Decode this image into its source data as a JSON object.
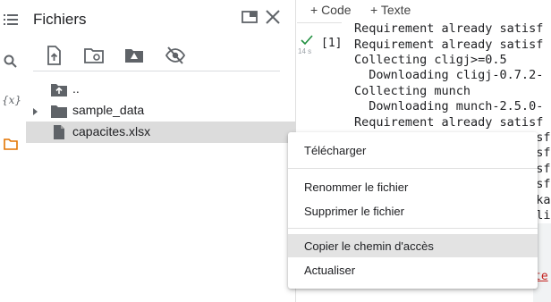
{
  "rail": {
    "icons": [
      "table-of-contents-icon",
      "search-icon",
      "variables-icon",
      "folder-icon"
    ],
    "variables_glyph": "{x}"
  },
  "panel": {
    "title": "Fichiers",
    "toolbar": [
      "upload-file-icon",
      "refresh-folder-icon",
      "mount-drive-icon",
      "hide-files-icon"
    ],
    "items": [
      {
        "label": "..",
        "icon": "parent-folder-icon",
        "expandable": false,
        "selected": false
      },
      {
        "label": "sample_data",
        "icon": "folder-icon",
        "expandable": true,
        "selected": false
      },
      {
        "label": "capacites.xlsx",
        "icon": "file-icon",
        "expandable": false,
        "selected": true
      }
    ]
  },
  "notebook": {
    "add_code": "+ Code",
    "add_text": "+ Texte",
    "exec_count": "[1]",
    "runtime": "14 s",
    "output_lines": [
      "Requirement already satisf",
      "Requirement already satisf",
      "Collecting cligj>=0.5",
      "  Downloading cligj-0.7.2-",
      "Collecting munch",
      "  Downloading munch-2.5.0-",
      "Requirement already satisf",
      "                         sf",
      "                         sf",
      "                         sf",
      "                         sf",
      "                         ka",
      "                         li"
    ],
    "error_fragment": "te"
  },
  "context_menu": {
    "items": [
      {
        "label": "Télécharger",
        "hover": false
      },
      {
        "label": "Renommer le fichier",
        "hover": false
      },
      {
        "label": "Supprimer le fichier",
        "hover": false
      },
      {
        "label": "Copier le chemin d'accès",
        "hover": true
      },
      {
        "label": "Actualiser",
        "hover": false
      }
    ]
  },
  "colors": {
    "accent_orange": "#e37400",
    "success_green": "#1e8e3e",
    "selected_row": "#dcdcdc",
    "menu_hover": "#e3e3e3"
  }
}
